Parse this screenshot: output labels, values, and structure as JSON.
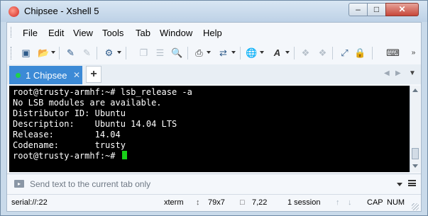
{
  "window": {
    "title": "Chipsee - Xshell 5"
  },
  "menu": [
    "File",
    "Edit",
    "View",
    "Tools",
    "Tab",
    "Window",
    "Help"
  ],
  "tabs": [
    {
      "label": "1 Chipsee",
      "status": "connected",
      "status_color": "#1fd14a"
    }
  ],
  "colors": {
    "accent": "#3c8ad6",
    "terminal_bg": "#000000",
    "terminal_fg": "#ffffff",
    "cursor": "#18d218"
  },
  "terminal": {
    "lines": [
      "root@trusty-armhf:~# lsb_release -a",
      "No LSB modules are available.",
      "Distributor ID: Ubuntu",
      "Description:    Ubuntu 14.04 LTS",
      "Release:        14.04",
      "Codename:       trusty"
    ],
    "prompt": "root@trusty-armhf:~# "
  },
  "compose": {
    "placeholder": "Send text to the current tab only"
  },
  "status": {
    "connection": "serial://:22",
    "terminal_type": "xterm",
    "size": "79x7",
    "cursor_pos": "7,22",
    "sessions": "1 session",
    "cap": "CAP",
    "num": "NUM"
  }
}
